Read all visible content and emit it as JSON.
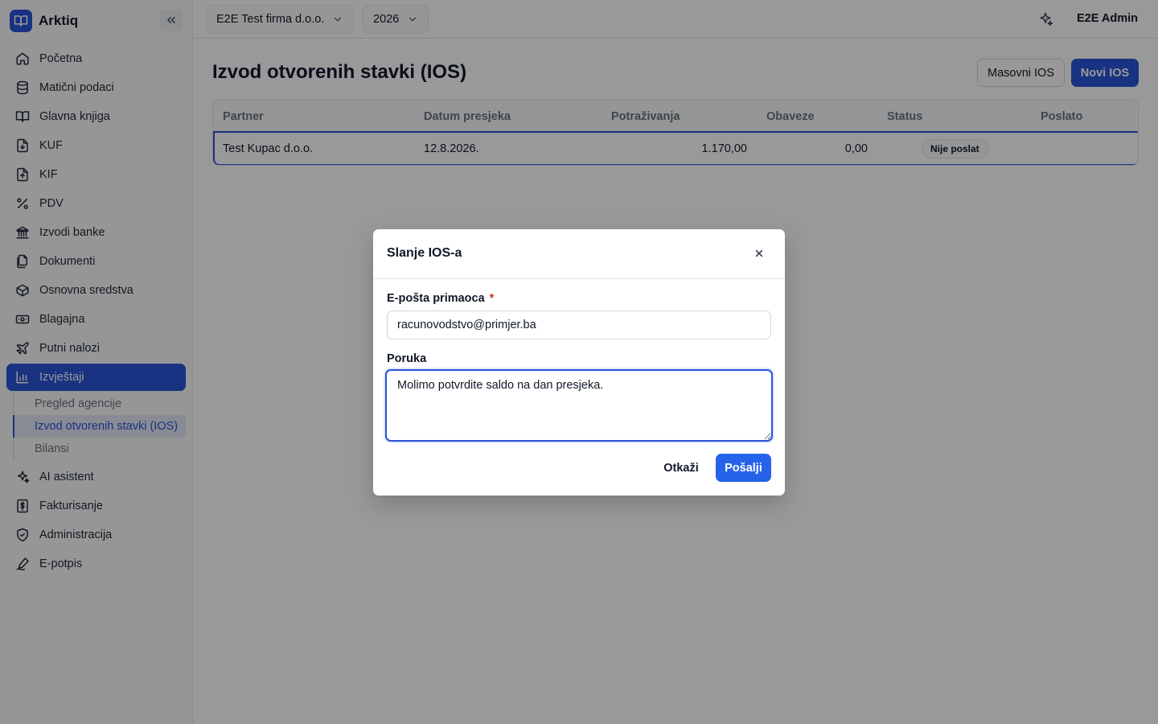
{
  "app": {
    "brand": "Arktiq"
  },
  "topbar": {
    "company": "E2E Test firma d.o.o.",
    "year": "2026",
    "user": "E2E Admin"
  },
  "sidebar": {
    "items": [
      {
        "label": "Početna",
        "icon": "home-icon"
      },
      {
        "label": "Matični podaci",
        "icon": "database-icon"
      },
      {
        "label": "Glavna knjiga",
        "icon": "book-open-icon"
      },
      {
        "label": "KUF",
        "icon": "file-download-icon"
      },
      {
        "label": "KIF",
        "icon": "file-upload-icon"
      },
      {
        "label": "PDV",
        "icon": "percent-icon"
      },
      {
        "label": "Izvodi banke",
        "icon": "bank-icon"
      },
      {
        "label": "Dokumenti",
        "icon": "documents-icon"
      },
      {
        "label": "Osnovna sredstva",
        "icon": "box-icon"
      },
      {
        "label": "Blagajna",
        "icon": "banknote-icon"
      },
      {
        "label": "Putni nalozi",
        "icon": "plane-icon"
      },
      {
        "label": "Izvještaji",
        "icon": "bar-chart-icon",
        "active": true
      }
    ],
    "subitems": [
      {
        "label": "Pregled agencije"
      },
      {
        "label": "Izvod otvorenih stavki (IOS)",
        "active": true
      },
      {
        "label": "Bilansi"
      }
    ],
    "items_after": [
      {
        "label": "AI asistent",
        "icon": "sparkles-icon"
      },
      {
        "label": "Fakturisanje",
        "icon": "invoice-dollar-icon"
      },
      {
        "label": "Administracija",
        "icon": "shield-check-icon"
      },
      {
        "label": "E-potpis",
        "icon": "pen-sign-icon"
      }
    ]
  },
  "page": {
    "title": "Izvod otvorenih stavki (IOS)",
    "bulk_button": "Masovni IOS",
    "new_button": "Novi IOS"
  },
  "table": {
    "columns": [
      "Partner",
      "Datum presjeka",
      "Potraživanja",
      "Obaveze",
      "Status",
      "Poslato"
    ],
    "rows": [
      {
        "partner": "Test Kupac d.o.o.",
        "date": "12.8.2026.",
        "receivables": "1.170,00",
        "payables": "0,00",
        "status": "Nije poslat",
        "sent": ""
      }
    ]
  },
  "modal": {
    "title": "Slanje IOS-a",
    "email_label": "E-pošta primaoca",
    "required_mark": "*",
    "email_value": "racunovodstvo@primjer.ba",
    "message_label": "Poruka",
    "message_value": "Molimo potvrdite saldo na dan presjeka.",
    "cancel": "Otkaži",
    "send": "Pošalji"
  },
  "colors": {
    "primary": "#2b54d9",
    "send_button": "#2563eb",
    "required": "#dc2626"
  }
}
